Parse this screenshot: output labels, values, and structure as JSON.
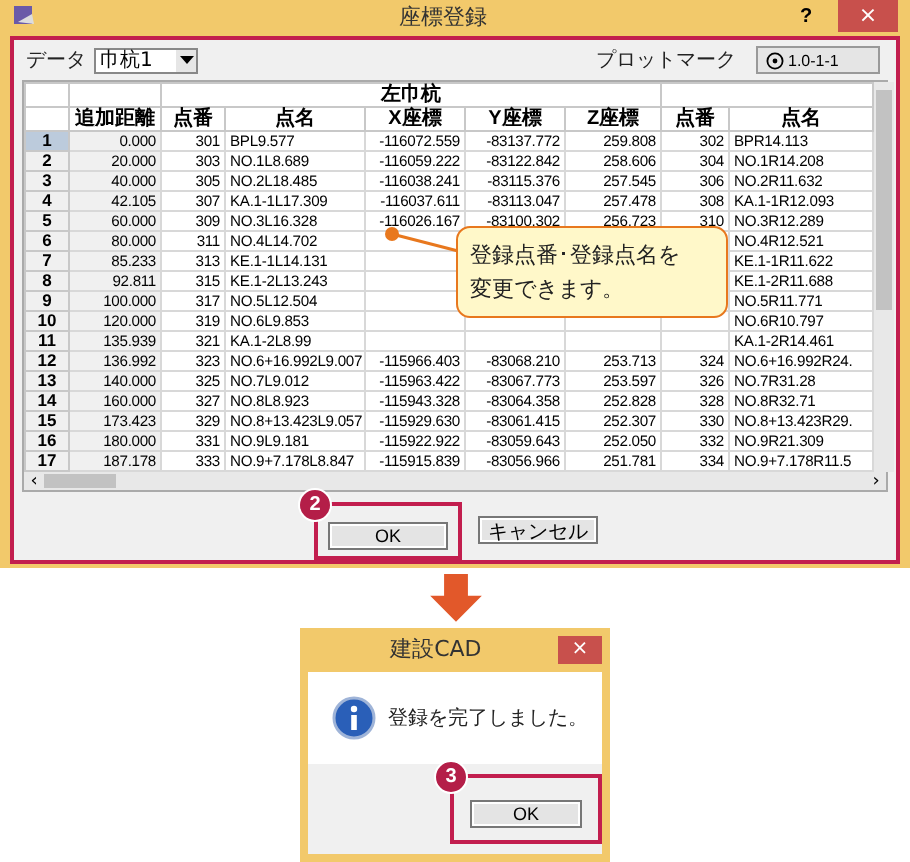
{
  "window": {
    "title": "座標登録",
    "help": "?",
    "close": "×"
  },
  "data_field": {
    "label": "データ",
    "value": "巾杭1"
  },
  "plot_mark": {
    "label": "プロットマーク",
    "value": "1.0-1-1"
  },
  "table": {
    "group_header": "左巾杭",
    "columns": [
      "追加距離",
      "点番",
      "点名",
      "X座標",
      "Y座標",
      "Z座標",
      "点番",
      "点名"
    ],
    "rows": [
      {
        "number": "1",
        "selected": true,
        "cells": [
          "0.000",
          "301",
          "BPL9.577",
          "-116072.559",
          "-83137.772",
          "259.808",
          "302",
          "BPR14.113"
        ]
      },
      {
        "number": "2",
        "selected": false,
        "cells": [
          "20.000",
          "303",
          "NO.1L8.689",
          "-116059.222",
          "-83122.842",
          "258.606",
          "304",
          "NO.1R14.208"
        ]
      },
      {
        "number": "3",
        "selected": false,
        "cells": [
          "40.000",
          "305",
          "NO.2L18.485",
          "-116038.241",
          "-83115.376",
          "257.545",
          "306",
          "NO.2R11.632"
        ]
      },
      {
        "number": "4",
        "selected": false,
        "cells": [
          "42.105",
          "307",
          "KA.1-1L17.309",
          "-116037.611",
          "-83113.047",
          "257.478",
          "308",
          "KA.1-1R12.093"
        ]
      },
      {
        "number": "5",
        "selected": false,
        "cells": [
          "60.000",
          "309",
          "NO.3L16.328",
          "-116026.167",
          "-83100.302",
          "256.723",
          "310",
          "NO.3R12.289"
        ]
      },
      {
        "number": "6",
        "selected": false,
        "cells": [
          "80.000",
          "311",
          "NO.4L14.702",
          null,
          null,
          null,
          null,
          "NO.4R12.521"
        ]
      },
      {
        "number": "7",
        "selected": false,
        "cells": [
          "85.233",
          "313",
          "KE.1-1L14.131",
          null,
          null,
          null,
          null,
          "KE.1-1R11.622"
        ]
      },
      {
        "number": "8",
        "selected": false,
        "cells": [
          "92.811",
          "315",
          "KE.1-2L13.243",
          null,
          null,
          null,
          null,
          "KE.1-2R11.688"
        ]
      },
      {
        "number": "9",
        "selected": false,
        "cells": [
          "100.000",
          "317",
          "NO.5L12.504",
          null,
          null,
          null,
          null,
          "NO.5R11.771"
        ]
      },
      {
        "number": "10",
        "selected": false,
        "cells": [
          "120.000",
          "319",
          "NO.6L9.853",
          null,
          null,
          null,
          null,
          "NO.6R10.797"
        ]
      },
      {
        "number": "11",
        "selected": false,
        "cells": [
          "135.939",
          "321",
          "KA.1-2L8.99",
          null,
          null,
          null,
          null,
          "KA.1-2R14.461"
        ]
      },
      {
        "number": "12",
        "selected": false,
        "cells": [
          "136.992",
          "323",
          "NO.6+16.992L9.007",
          "-115966.403",
          "-83068.210",
          "253.713",
          "324",
          "NO.6+16.992R24."
        ]
      },
      {
        "number": "13",
        "selected": false,
        "cells": [
          "140.000",
          "325",
          "NO.7L9.012",
          "-115963.422",
          "-83067.773",
          "253.597",
          "326",
          "NO.7R31.28"
        ]
      },
      {
        "number": "14",
        "selected": false,
        "cells": [
          "160.000",
          "327",
          "NO.8L8.923",
          "-115943.328",
          "-83064.358",
          "252.828",
          "328",
          "NO.8R32.71"
        ]
      },
      {
        "number": "15",
        "selected": false,
        "cells": [
          "173.423",
          "329",
          "NO.8+13.423L9.057",
          "-115929.630",
          "-83061.415",
          "252.307",
          "330",
          "NO.8+13.423R29."
        ]
      },
      {
        "number": "16",
        "selected": false,
        "cells": [
          "180.000",
          "331",
          "NO.9L9.181",
          "-115922.922",
          "-83059.643",
          "252.050",
          "332",
          "NO.9R21.309"
        ]
      },
      {
        "number": "17",
        "selected": false,
        "cells": [
          "187.178",
          "333",
          "NO.9+7.178L8.847",
          "-115915.839",
          "-83056.966",
          "251.781",
          "334",
          "NO.9+7.178R11.5"
        ]
      }
    ]
  },
  "scrollbar": {
    "left_arrow": "‹",
    "right_arrow": "›"
  },
  "callout": {
    "lines": [
      "登録点番･登録点名を",
      "変更できます。"
    ]
  },
  "buttons": [
    {
      "label": "OK",
      "step": "2"
    },
    {
      "label": "キャンセル"
    }
  ],
  "message_dialog": {
    "title": "建設CAD",
    "close": "×",
    "message": "登録を完了しました。",
    "button": "OK",
    "step": "3"
  }
}
